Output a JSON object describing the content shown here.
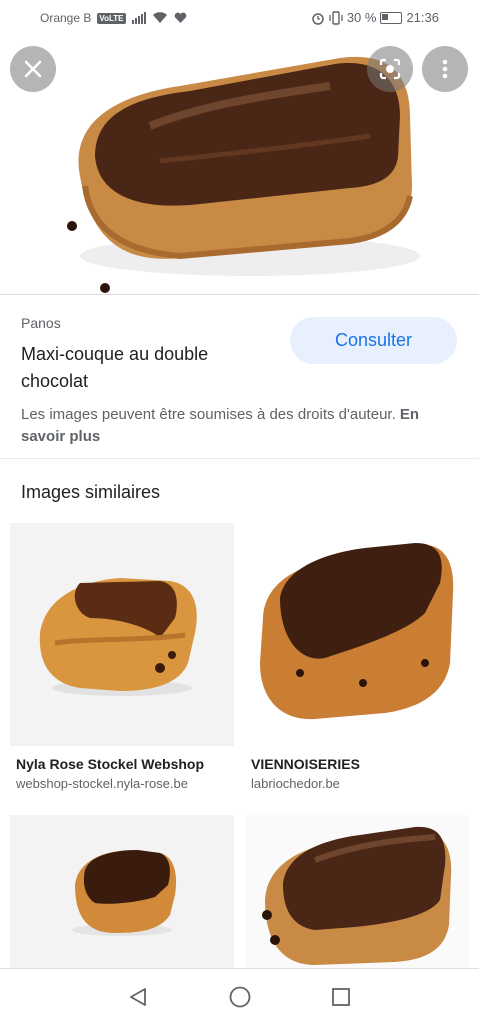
{
  "status_bar": {
    "carrier": "Orange B",
    "volte": "VoLTE",
    "battery": "30 %",
    "time": "21:36"
  },
  "hero": {
    "close_icon": "close-icon",
    "lens_icon": "google-lens-icon",
    "menu_icon": "more-vert-icon"
  },
  "result": {
    "source": "Panos",
    "title": "Maxi-couque au double chocolat",
    "visit_label": "Consulter",
    "copyright_text": "Les images peuvent être soumises à des droits d'auteur.",
    "learn_more": "En savoir plus"
  },
  "similar": {
    "heading": "Images similaires",
    "items": [
      {
        "title": "Nyla Rose Stockel Webshop",
        "domain": "webshop-stockel.nyla-rose.be"
      },
      {
        "title": "VIENNOISERIES",
        "domain": "labriochedor.be"
      },
      {
        "title": "",
        "domain": ""
      },
      {
        "title": "",
        "domain": ""
      }
    ]
  },
  "nav": {
    "back_icon": "back-icon",
    "home_icon": "home-icon",
    "recents_icon": "recents-icon"
  },
  "colors": {
    "accent": "#1a73e8",
    "button_bg": "#e8f0fe",
    "chocolate": "#4a2616",
    "pastry": "#c98a45"
  }
}
